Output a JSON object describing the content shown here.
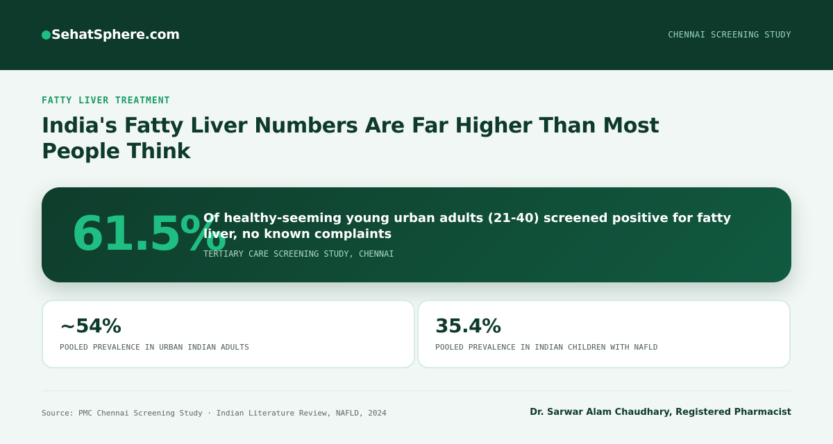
{
  "header": {
    "brand_name": "SehatSphere.com",
    "tagline": "CHENNAI SCREENING STUDY"
  },
  "article": {
    "category": "FATTY LIVER TREATMENT",
    "title": "India's Fatty Liver Numbers Are Far Higher Than Most People Think"
  },
  "hero_stat": {
    "value": "61.5%",
    "description": "Of healthy-seeming young urban adults (21-40) screened positive for fatty liver, no known complaints",
    "source": "TERTIARY CARE SCREENING STUDY, CHENNAI"
  },
  "stat_cards": [
    {
      "value": "~54%",
      "label": "POOLED PREVALENCE IN URBAN INDIAN ADULTS"
    },
    {
      "value": "35.4%",
      "label": "POOLED PREVALENCE IN INDIAN CHILDREN WITH NAFLD"
    }
  ],
  "footer": {
    "source": "Source: PMC Chennai Screening Study · Indian Literature Review, NAFLD, 2024",
    "author": "Dr. Sarwar Alam Chaudhary, Registered Pharmacist"
  },
  "colors": {
    "header_bg": "#0d3a2a",
    "accent": "#1fbf83",
    "page_bg": "#f1f7f4"
  }
}
